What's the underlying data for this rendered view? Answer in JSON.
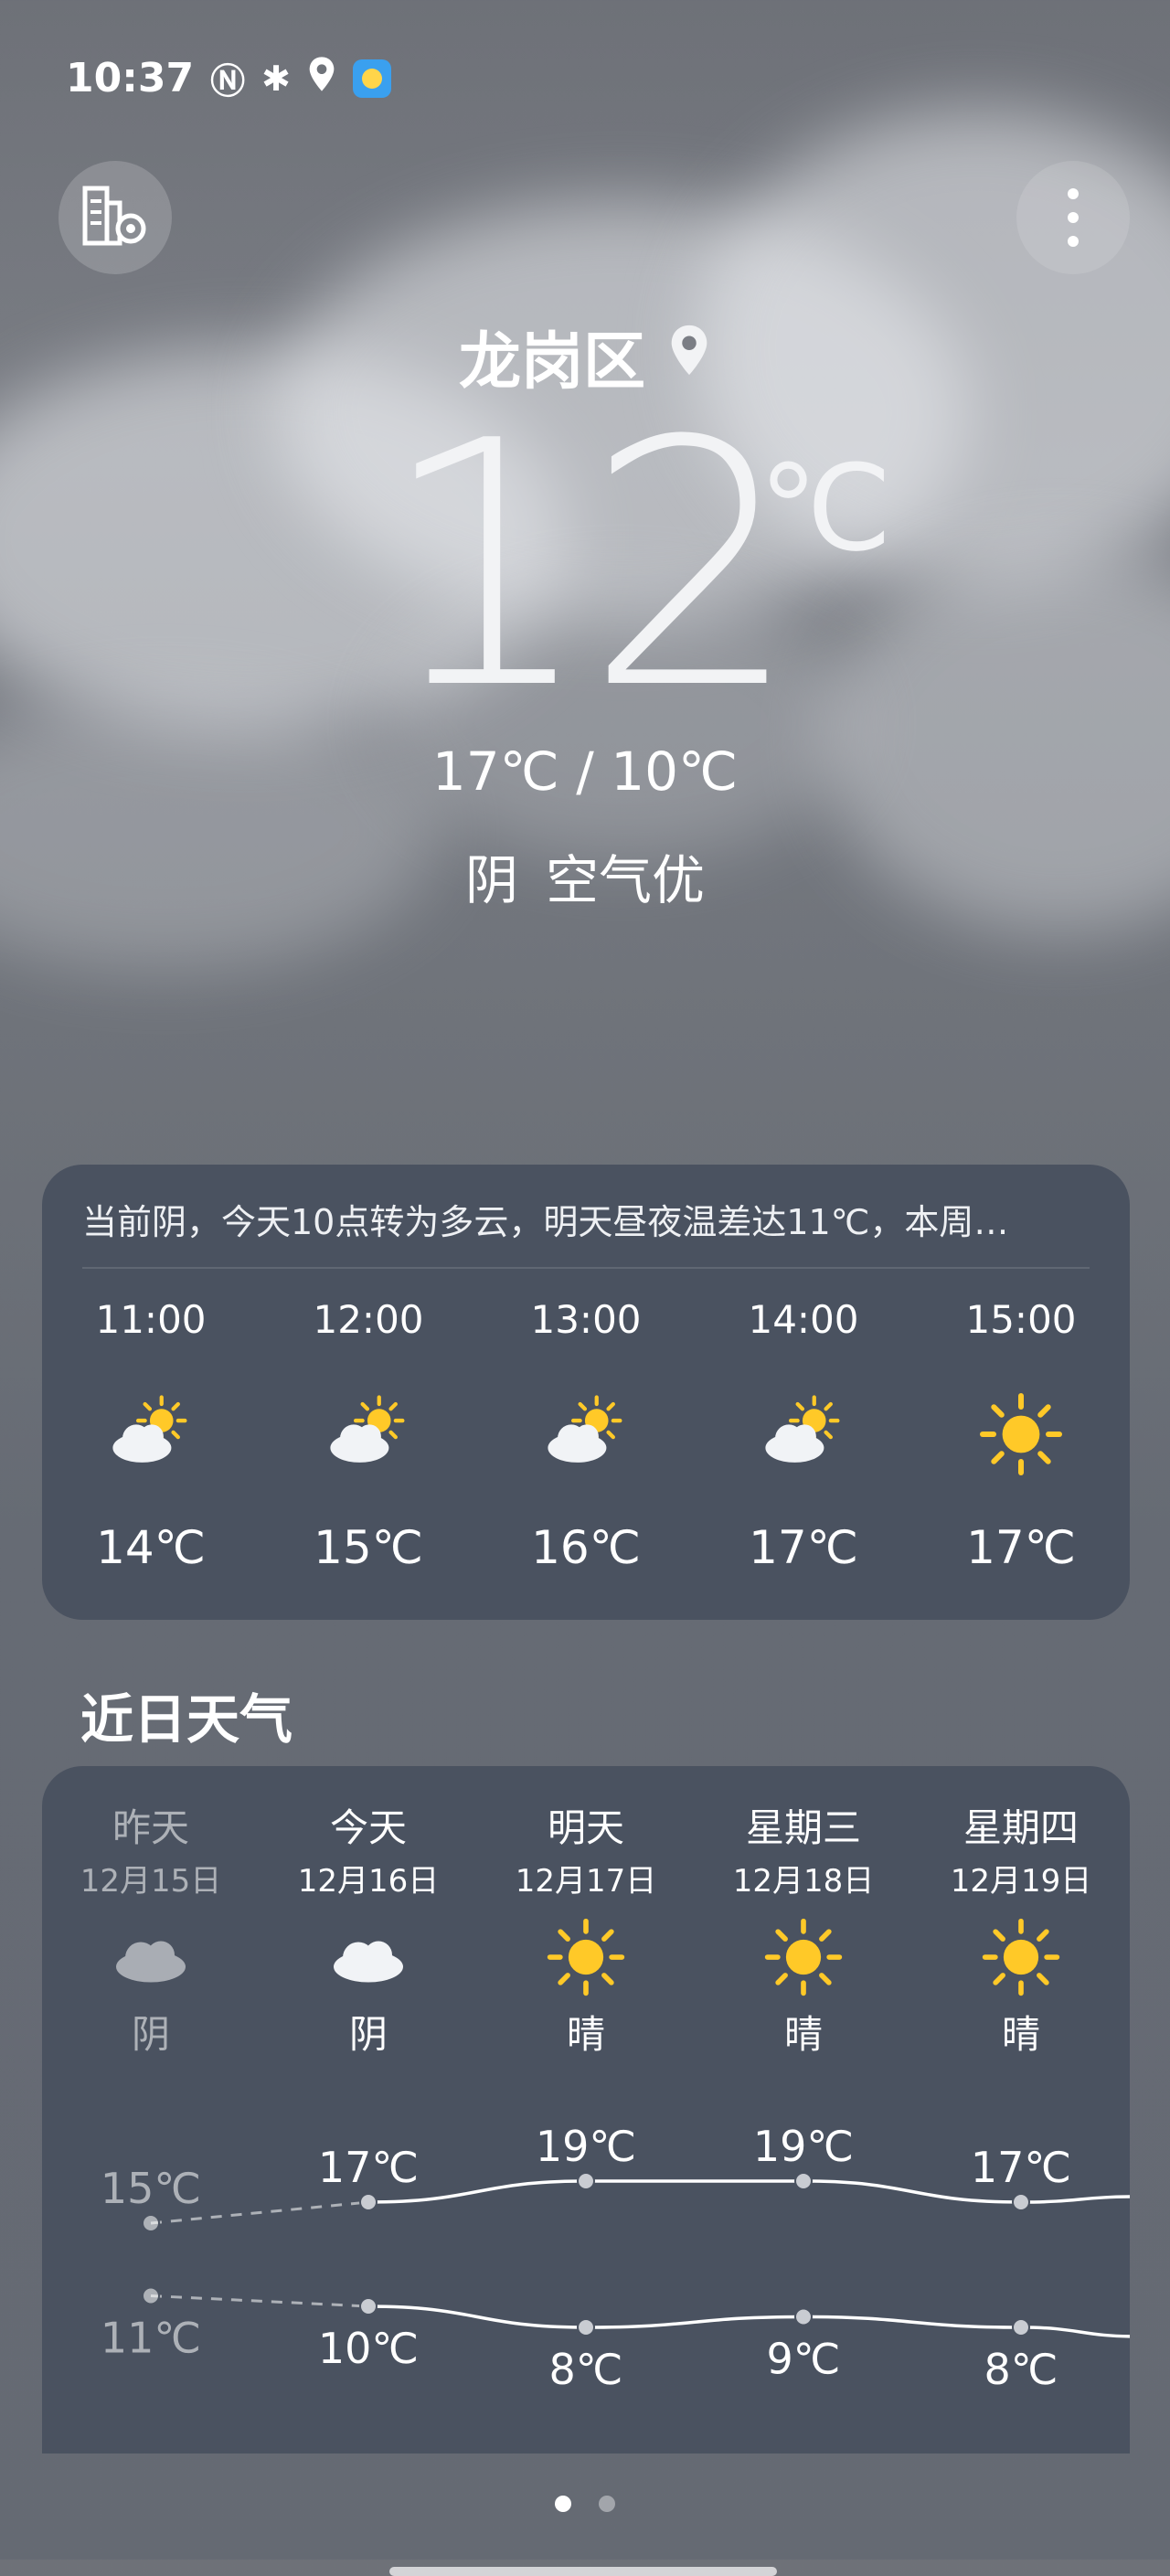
{
  "status_bar": {
    "time": "10:37",
    "icons": [
      "nfc-icon",
      "bluetooth-icon",
      "location-icon",
      "weather-app-icon"
    ]
  },
  "header": {
    "city_manage_icon": "city-settings-icon",
    "more_icon": "more-vertical-icon"
  },
  "location": {
    "name": "龙岗区",
    "icon": "location-pin-icon"
  },
  "current": {
    "temperature": "12",
    "unit": "℃",
    "range": "17℃ / 10℃",
    "condition": "阴",
    "air_quality": "空气优"
  },
  "hourly": {
    "summary": "当前阴，今天10点转为多云，明天昼夜温差达11℃，本周…",
    "items": [
      {
        "time": "11:00",
        "icon": "partly-cloudy-icon",
        "temp": "14℃"
      },
      {
        "time": "12:00",
        "icon": "partly-cloudy-icon",
        "temp": "15℃"
      },
      {
        "time": "13:00",
        "icon": "partly-cloudy-icon",
        "temp": "16℃"
      },
      {
        "time": "14:00",
        "icon": "partly-cloudy-icon",
        "temp": "17℃"
      },
      {
        "time": "15:00",
        "icon": "sunny-icon",
        "temp": "17℃"
      }
    ]
  },
  "daily": {
    "title": "近日天气",
    "items": [
      {
        "name": "昨天",
        "date": "12月15日",
        "icon": "cloudy-icon",
        "condition": "阴",
        "high": "15℃",
        "low": "11℃",
        "high_value": 15,
        "low_value": 11,
        "past": true
      },
      {
        "name": "今天",
        "date": "12月16日",
        "icon": "cloudy-icon",
        "condition": "阴",
        "high": "17℃",
        "low": "10℃",
        "high_value": 17,
        "low_value": 10,
        "past": false
      },
      {
        "name": "明天",
        "date": "12月17日",
        "icon": "sunny-icon",
        "condition": "晴",
        "high": "19℃",
        "low": "8℃",
        "high_value": 19,
        "low_value": 8,
        "past": false
      },
      {
        "name": "星期三",
        "date": "12月18日",
        "icon": "sunny-icon",
        "condition": "晴",
        "high": "19℃",
        "low": "9℃",
        "high_value": 19,
        "low_value": 9,
        "past": false
      },
      {
        "name": "星期四",
        "date": "12月19日",
        "icon": "sunny-icon",
        "condition": "晴",
        "high": "17℃",
        "low": "8℃",
        "high_value": 17,
        "low_value": 8,
        "past": false
      }
    ]
  },
  "pager": {
    "pages": 2,
    "active": 0
  },
  "colors": {
    "card": "#4a5260",
    "sun": "#ffc928",
    "cloud": "#f1f3f6"
  }
}
